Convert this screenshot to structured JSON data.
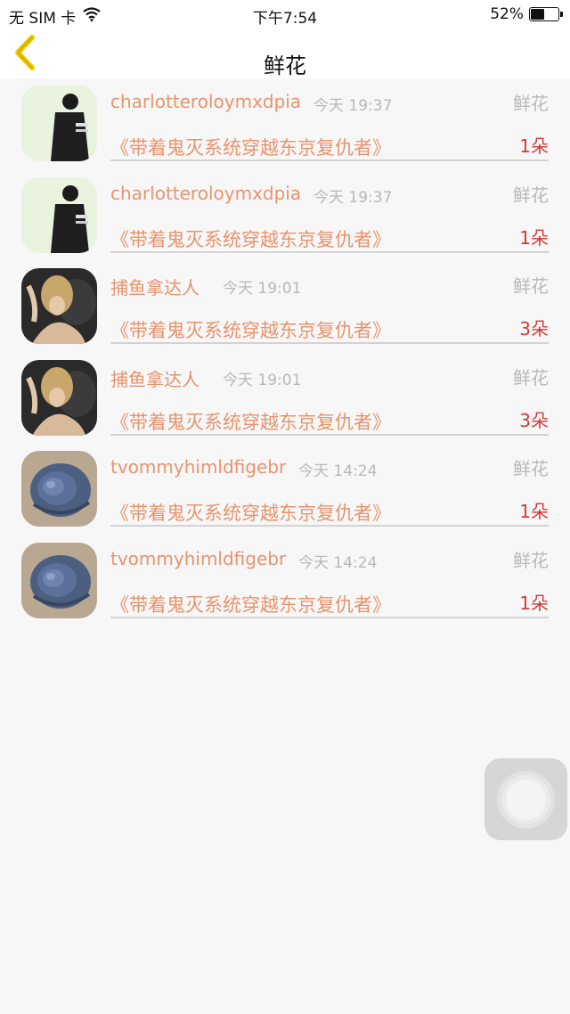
{
  "status_bar": {
    "carrier": "无 SIM 卡",
    "time": "下午7:54",
    "battery": "52%",
    "battery_level": 0.52
  },
  "nav": {
    "title": "鲜花",
    "back_icon": "chevron-left-icon",
    "accent_color": "#f0c800"
  },
  "rows": [
    {
      "username": "charlotteroloymxdpia",
      "time": "今天 19:37",
      "gift": "鲜花",
      "book": "《带着鬼灭系统穿越东京复仇者》",
      "count": "1朵",
      "avatar": "person-in-jacket"
    },
    {
      "username": "charlotteroloymxdpia",
      "time": "今天 19:37",
      "gift": "鲜花",
      "book": "《带着鬼灭系统穿越东京复仇者》",
      "count": "1朵",
      "avatar": "person-in-jacket"
    },
    {
      "username": "捕鱼拿达人",
      "time": "今天 19:01",
      "gift": "鲜花",
      "book": "《带着鬼灭系统穿越东京复仇者》",
      "count": "3朵",
      "avatar": "blonde-woman"
    },
    {
      "username": "捕鱼拿达人",
      "time": "今天 19:01",
      "gift": "鲜花",
      "book": "《带着鬼灭系统穿越东京复仇者》",
      "count": "3朵",
      "avatar": "blonde-woman"
    },
    {
      "username": "tvommyhimldfigebr",
      "time": "今天 14:24",
      "gift": "鲜花",
      "book": "《带着鬼灭系统穿越东京复仇者》",
      "count": "1朵",
      "avatar": "blue-shell"
    },
    {
      "username": "tvommyhimldfigebr",
      "time": "今天 14:24",
      "gift": "鲜花",
      "book": "《带着鬼灭系统穿越东京复仇者》",
      "count": "1朵",
      "avatar": "blue-shell"
    }
  ],
  "colors": {
    "username": "#e8936c",
    "time": "#b9b7b8",
    "count": "#d33a3a",
    "background": "#f8f7f8"
  },
  "assistive_touch_icon": "assistive-touch-icon"
}
